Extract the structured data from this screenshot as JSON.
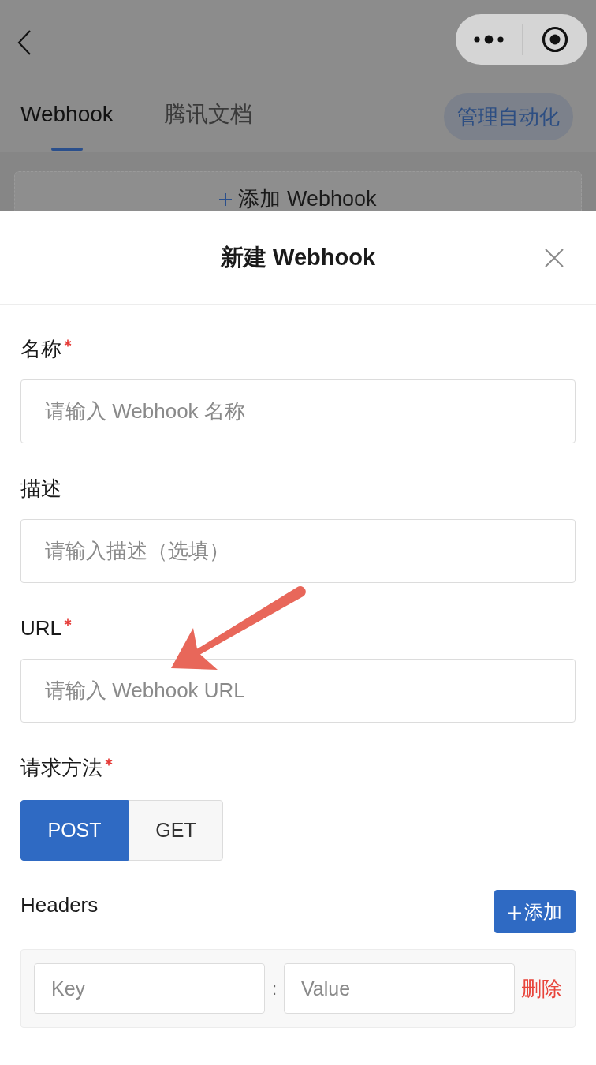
{
  "tabs": [
    {
      "label": "Webhook",
      "selected": true
    },
    {
      "label": "腾讯文档",
      "selected": false
    }
  ],
  "manage_button": {
    "label": "管理自动化"
  },
  "add_card": {
    "label": "添加 Webhook"
  },
  "dialog": {
    "title": "新建 Webhook",
    "fields": [
      {
        "label": "名称",
        "required": true,
        "placeholder": "请输入 Webhook 名称"
      },
      {
        "label": "描述",
        "required": false,
        "placeholder": "请输入描述（选填）"
      },
      {
        "label": "URL",
        "required": true,
        "placeholder": "请输入 Webhook URL"
      }
    ],
    "method": {
      "label": "请求方法",
      "required": true,
      "options": [
        {
          "label": "POST",
          "selected": true
        },
        {
          "label": "GET",
          "selected": false
        }
      ]
    },
    "headers": {
      "label": "Headers",
      "add_button": "添加",
      "rows": [
        {
          "key_placeholder": "Key",
          "separator": ":",
          "value_placeholder": "Value",
          "delete_label": "删除"
        }
      ]
    }
  }
}
